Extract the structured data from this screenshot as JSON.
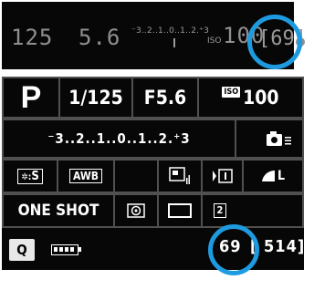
{
  "viewfinder": {
    "shutter": "125",
    "aperture": "5.6",
    "exposure_scale": "⁻3..2..1..0..1..2.⁺3",
    "iso_label": "ISO",
    "iso": "100",
    "shots_remaining": "[69]"
  },
  "quick_control": {
    "mode": "P",
    "shutter": "1/125",
    "aperture": "F5.6",
    "iso_label": "ISO",
    "iso": "100",
    "exposure_comp": "⁻3..2..1..0..1..2.⁺3",
    "picture_style": "S",
    "white_balance": "AWB",
    "image_quality": "L",
    "af_mode": "ONE SHOT",
    "drive_self_timer_label": "2",
    "q_button": "Q",
    "shots_remaining": "69",
    "max_burst": "[ 514]"
  },
  "colors": {
    "highlight_circle": "#1e9be0",
    "screen_bg": "#070707",
    "grid_line": "#505050"
  },
  "battery_level": 1.0
}
